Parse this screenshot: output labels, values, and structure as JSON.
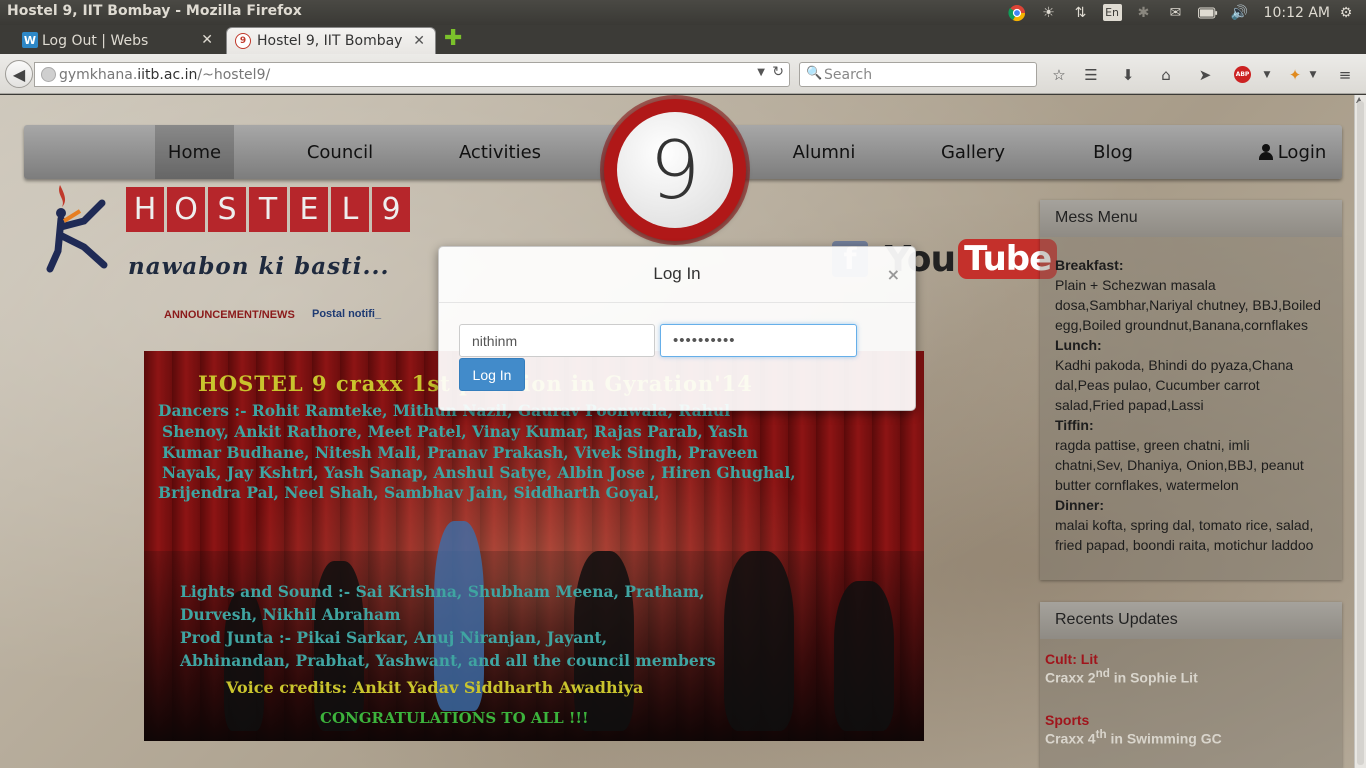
{
  "window": {
    "title": "Hostel 9, IIT Bombay - Mozilla Firefox"
  },
  "tray": {
    "keyboard": "En",
    "clock": "10:12 AM"
  },
  "tabs": [
    {
      "label": "Log Out | Webs",
      "favicon": "W"
    },
    {
      "label": "Hostel 9, IIT Bombay",
      "favicon": "9"
    }
  ],
  "urlbar": {
    "host_prefix": "gymkhana.",
    "host": "iitb.ac.in",
    "path": "/~hostel9/"
  },
  "search": {
    "placeholder": "Search"
  },
  "toolbar": {
    "adblock": "ABP"
  },
  "site_nav": {
    "home": "Home",
    "council": "Council",
    "activities": "Activities",
    "logo_number": "9",
    "alumni": "Alumni",
    "gallery": "Gallery",
    "blog": "Blog",
    "login": "Login"
  },
  "brand": {
    "letters": [
      "H",
      "O",
      "S",
      "T",
      "E",
      "L",
      "9"
    ],
    "tagline": "nawabon ki basti...",
    "facebook": "f",
    "youtube_you": "You",
    "youtube_tube": "Tube"
  },
  "announcement": {
    "label": "ANNOUNCEMENT/NEWS",
    "ticker": "Postal notifi_"
  },
  "banner": {
    "title": "HOSTEL 9 craxx 1st position in Gyration'14",
    "dancers_1": "Dancers :- Rohit Ramteke, Mithun Nazil, Gaurav Poonwala, Rahul",
    "dancers_2": "Shenoy, Ankit Rathore,  Meet Patel, Vinay Kumar, Rajas Parab, Yash",
    "dancers_3": "Kumar Budhane, Nitesh Mali, Pranav Prakash, Vivek Singh, Praveen",
    "dancers_4": "Nayak, Jay Kshtri, Yash Sanap, Anshul Satye, Albin Jose , Hiren Ghughal,",
    "dancers_5": "Brijendra Pal, Neel Shah, Sambhav Jain, Siddharth Goyal,",
    "light_1": "Lights and Sound :- Sai Krishna, Shubham Meena, Pratham,",
    "light_2": "Durvesh, Nikhil Abraham",
    "prod_1": "Prod Junta :- Pikai Sarkar, Anuj Niranjan, Jayant,",
    "prod_2": "Abhinandan, Prabhat, Yashwant, and all the council members",
    "voice": "Voice credits: Ankit Yadav Siddharth Awadhiya",
    "congrats": "CONGRATULATIONS TO ALL !!!"
  },
  "mess_menu": {
    "title": "Mess Menu",
    "breakfast_h": "Breakfast:",
    "breakfast_1": "Plain + Schezwan masala",
    "breakfast_2": "dosa,Sambhar,Nariyal chutney, BBJ,Boiled",
    "breakfast_3": "egg,Boiled groundnut,Banana,cornflakes",
    "lunch_h": "Lunch:",
    "lunch_1": "Kadhi pakoda, Bhindi do pyaza,Chana",
    "lunch_2": "dal,Peas pulao, Cucumber carrot",
    "lunch_3": "salad,Fried papad,Lassi",
    "tiffin_h": "Tiffin:",
    "tiffin_1": "ragda pattise, green chatni, imli",
    "tiffin_2": "chatni,Sev, Dhaniya, Onion,BBJ, peanut",
    "tiffin_3": "butter cornflakes, watermelon",
    "dinner_h": "Dinner:",
    "dinner_1": "malai kofta, spring dal, tomato rice, salad,",
    "dinner_2": "fried papad, boondi raita, motichur laddoo"
  },
  "updates": {
    "title": "Recents Updates",
    "item1_cat": "Cult: Lit",
    "item1_a": "Craxx 2",
    "item1_sup": "nd",
    "item1_b": " in Sophie Lit",
    "item2_cat": "Sports",
    "item2_a": "Craxx 4",
    "item2_sup": "th",
    "item2_b": " in Swimming GC"
  },
  "login_modal": {
    "title": "Log In",
    "close": "×",
    "username_value": "nithinm",
    "password_value": "••••••••••",
    "submit": "Log In"
  },
  "colors": {
    "accent_red": "#b6262b",
    "bootstrap_blue": "#428bca",
    "nav_gray": "#8f8f8f"
  }
}
